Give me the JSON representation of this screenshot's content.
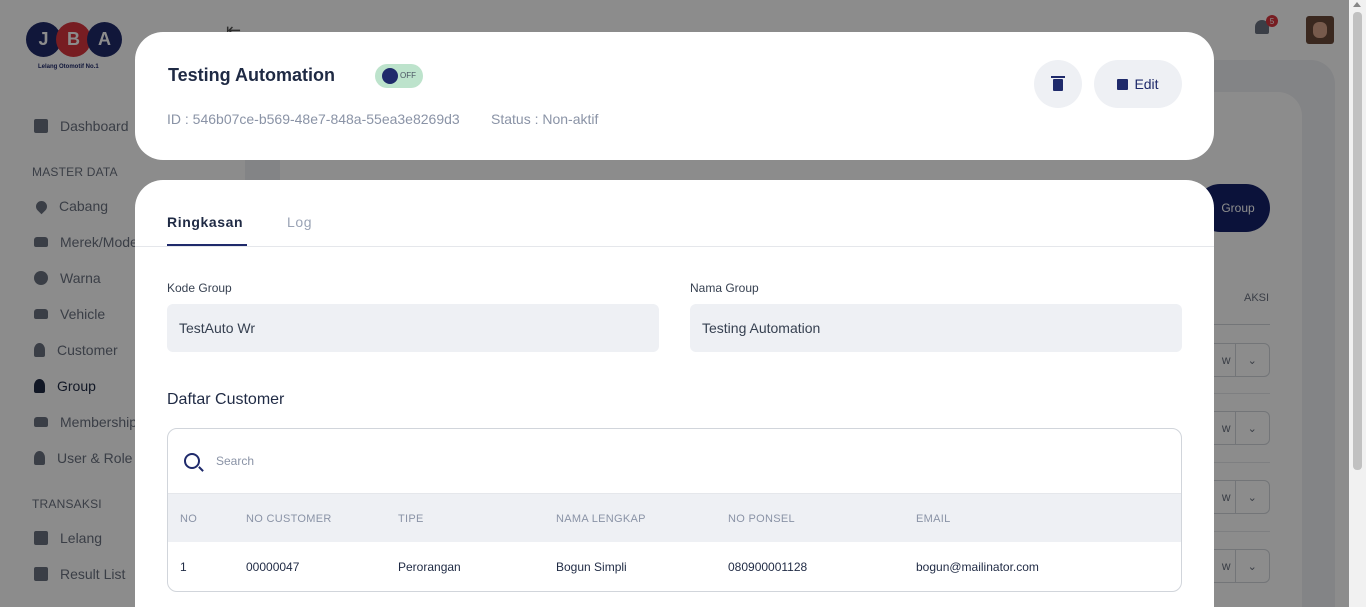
{
  "app": {
    "logo_letters": [
      "J",
      "B",
      "A"
    ],
    "logo_tagline": "Lelang Otomotif No.1",
    "notifications_count": "5",
    "background_group_button": "Group",
    "background_aksi_header": "AKSI",
    "background_row_button": "w"
  },
  "sidebar": {
    "dashboard": "Dashboard",
    "master_data_section": "MASTER DATA",
    "master_items": [
      "Cabang",
      "Merek/Model",
      "Warna",
      "Vehicle",
      "Customer",
      "Group",
      "Membership",
      "User & Role"
    ],
    "transaksi_section": "TRANSAKSI",
    "transaksi_items": [
      "Lelang",
      "Result List"
    ]
  },
  "modal": {
    "title": "Testing Automation",
    "toggle_label": "OFF",
    "id_text": "ID : 546b07ce-b569-48e7-848a-55ea3e8269d3",
    "status_text": "Status : Non-aktif",
    "edit_label": "Edit",
    "tabs": [
      "Ringkasan",
      "Log"
    ],
    "kode_group_label": "Kode Group",
    "kode_group_value": "TestAuto Wr",
    "nama_group_label": "Nama Group",
    "nama_group_value": "Testing Automation",
    "customer_section_title": "Daftar Customer",
    "search_placeholder": "Search",
    "columns": [
      "NO",
      "NO CUSTOMER",
      "TIPE",
      "NAMA LENGKAP",
      "NO PONSEL",
      "EMAIL"
    ],
    "rows": [
      [
        "1",
        "00000047",
        "Perorangan",
        "Bogun Simpli",
        "080900001128",
        "bogun@mailinator.com"
      ]
    ]
  }
}
